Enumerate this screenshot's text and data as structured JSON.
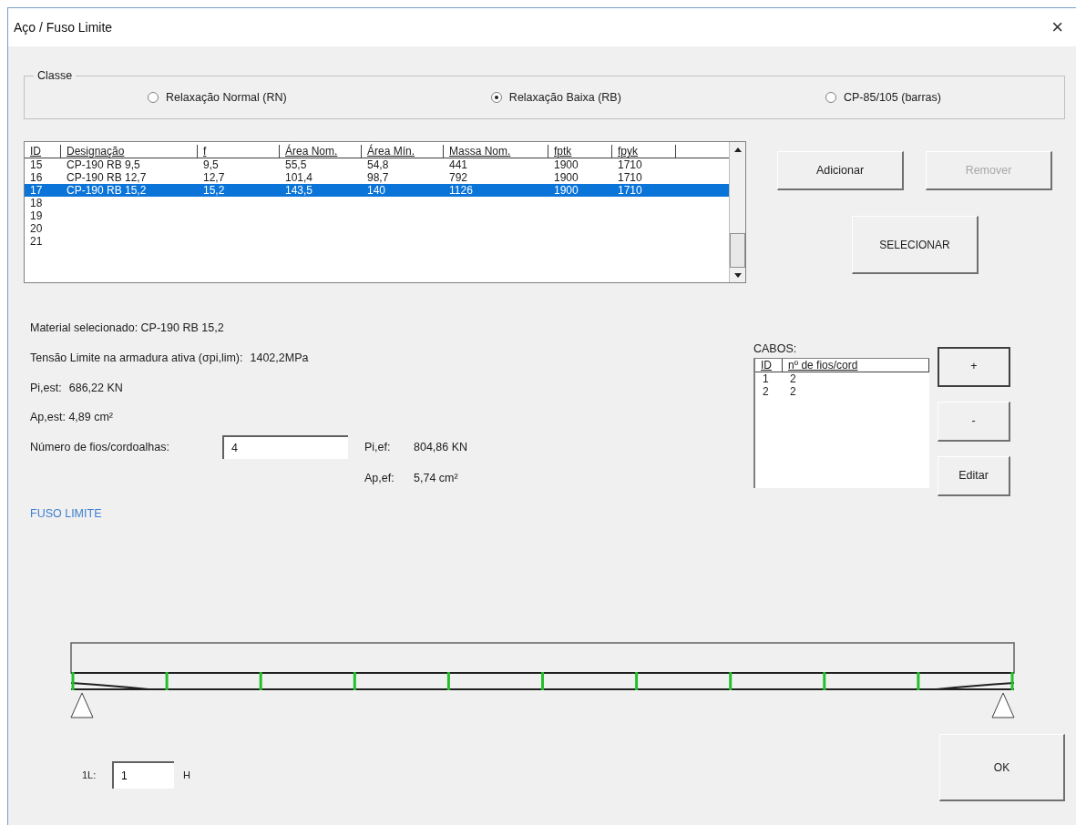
{
  "window": {
    "title": "Aço / Fuso Limite",
    "close": "×"
  },
  "classe": {
    "legend": "Classe",
    "options": [
      {
        "label": "Relaxação Normal (RN)",
        "selected": false
      },
      {
        "label": "Relaxação Baixa (RB)",
        "selected": true
      },
      {
        "label": "CP-85/105 (barras)",
        "selected": false
      }
    ]
  },
  "table": {
    "columns": [
      "ID",
      "Designação",
      "f",
      "Área Nom.",
      "Área Mín.",
      "Massa Nom.",
      "fptk",
      "fpyk"
    ],
    "rows": [
      {
        "cells": [
          "15",
          "CP-190 RB 9,5",
          "9,5",
          "55,5",
          "54,8",
          "441",
          "1900",
          "1710"
        ],
        "selected": false
      },
      {
        "cells": [
          "16",
          "CP-190 RB 12,7",
          "12,7",
          "101,4",
          "98,7",
          "792",
          "1900",
          "1710"
        ],
        "selected": false
      },
      {
        "cells": [
          "17",
          "CP-190 RB 15,2",
          "15,2",
          "143,5",
          "140",
          "1126",
          "1900",
          "1710"
        ],
        "selected": true
      },
      {
        "cells": [
          "18"
        ],
        "selected": false
      },
      {
        "cells": [
          "19"
        ],
        "selected": false
      },
      {
        "cells": [
          "20"
        ],
        "selected": false
      },
      {
        "cells": [
          "21"
        ],
        "selected": false
      }
    ]
  },
  "table_buttons": [
    {
      "label": "Adicionar",
      "disabled": false
    },
    {
      "label": "Remover",
      "disabled": true
    }
  ],
  "select_button": "SELECIONAR",
  "info": {
    "material": "Material selecionado: CP-190 RB 15,2",
    "tensao_label": "Tensão Limite na armadura ativa (σpi,lim):",
    "tensao_value": "1402,2MPa",
    "pi_est_label": "Pi,est:",
    "pi_est_value": "686,22 KN",
    "ap_est": "Ap,est: 4,89 cm²",
    "num_label": "Número de fios/cordoalhas:",
    "num_value": "4",
    "pi_ef_label": "Pi,ef:",
    "pi_ef_value": "804,86 KN",
    "ap_ef_label": "Ap,ef:",
    "ap_ef_value": "5,74 cm²",
    "fuso_link": "FUSO LIMITE"
  },
  "cabos": {
    "label": "CABOS:",
    "columns": [
      "ID",
      "nº de fios/cord"
    ],
    "rows": [
      [
        "1",
        "2"
      ],
      [
        "2",
        "2"
      ]
    ],
    "buttons": [
      {
        "label": "+",
        "focused": true
      },
      {
        "label": "-",
        "focused": false
      },
      {
        "label": "Editar",
        "focused": false
      }
    ]
  },
  "bottom": {
    "l_label": "1L:",
    "l_value": "1",
    "unit": "H",
    "ok": "OK"
  }
}
